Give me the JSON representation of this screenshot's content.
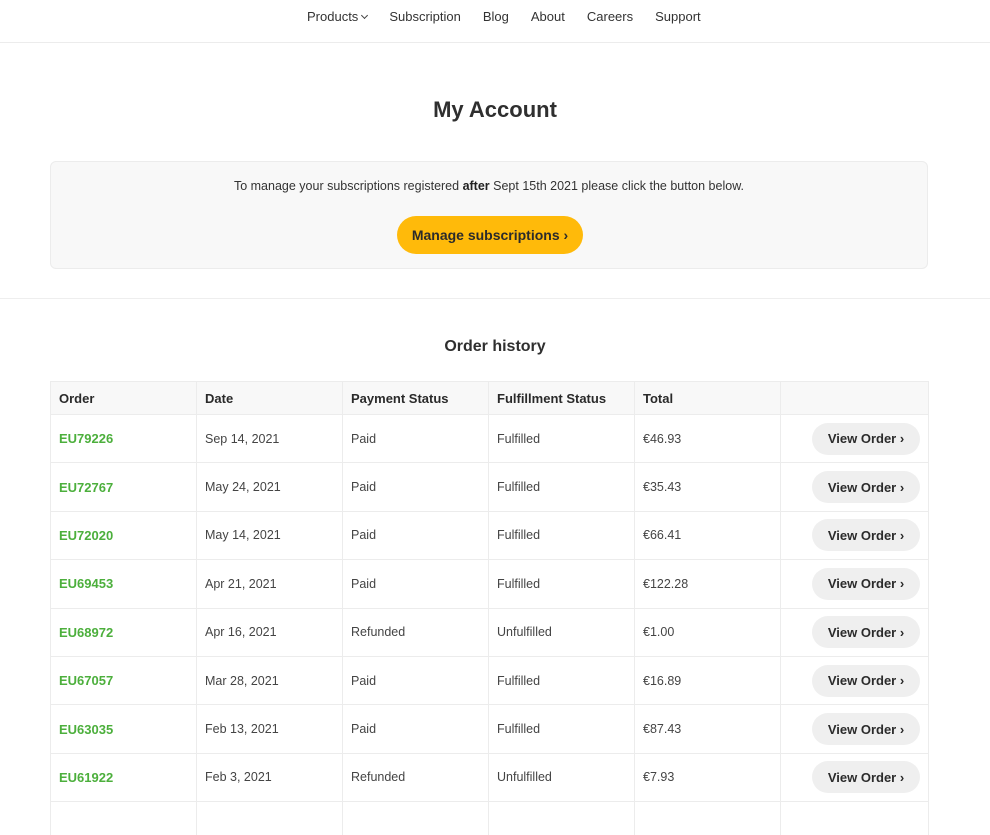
{
  "nav": {
    "items": [
      {
        "label": "Products",
        "has_dropdown": true
      },
      {
        "label": "Subscription"
      },
      {
        "label": "Blog"
      },
      {
        "label": "About"
      },
      {
        "label": "Careers"
      },
      {
        "label": "Support"
      }
    ]
  },
  "page": {
    "title": "My Account"
  },
  "manage": {
    "text_before": "To manage your subscriptions registered ",
    "text_bold": "after",
    "text_after": " Sept 15th 2021 please click the button below.",
    "button_label": "Manage subscriptions ›",
    "accent_color": "#ffba0a"
  },
  "orders": {
    "title": "Order history",
    "columns": [
      "Order",
      "Date",
      "Payment Status",
      "Fulfillment Status",
      "Total",
      ""
    ],
    "action_label": "View Order ›",
    "link_color": "#4caf3c",
    "rows": [
      {
        "order": "EU79226",
        "date": "Sep 14, 2021",
        "payment": "Paid",
        "fulfillment": "Fulfilled",
        "total": "€46.93"
      },
      {
        "order": "EU72767",
        "date": "May 24, 2021",
        "payment": "Paid",
        "fulfillment": "Fulfilled",
        "total": "€35.43"
      },
      {
        "order": "EU72020",
        "date": "May 14, 2021",
        "payment": "Paid",
        "fulfillment": "Fulfilled",
        "total": "€66.41"
      },
      {
        "order": "EU69453",
        "date": "Apr 21, 2021",
        "payment": "Paid",
        "fulfillment": "Fulfilled",
        "total": "€122.28"
      },
      {
        "order": "EU68972",
        "date": "Apr 16, 2021",
        "payment": "Refunded",
        "fulfillment": "Unfulfilled",
        "total": "€1.00"
      },
      {
        "order": "EU67057",
        "date": "Mar 28, 2021",
        "payment": "Paid",
        "fulfillment": "Fulfilled",
        "total": "€16.89"
      },
      {
        "order": "EU63035",
        "date": "Feb 13, 2021",
        "payment": "Paid",
        "fulfillment": "Fulfilled",
        "total": "€87.43"
      },
      {
        "order": "EU61922",
        "date": "Feb 3, 2021",
        "payment": "Refunded",
        "fulfillment": "Unfulfilled",
        "total": "€7.93"
      }
    ]
  }
}
